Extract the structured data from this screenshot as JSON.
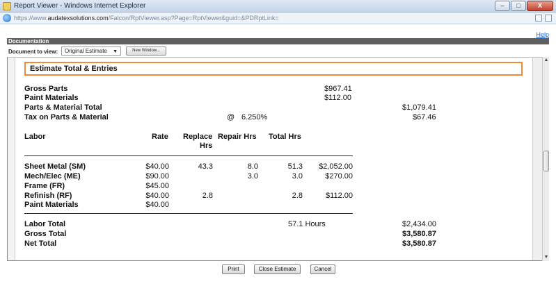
{
  "window": {
    "title": "Report Viewer - Windows Internet Explorer",
    "url_prefix": "https://www.",
    "url_domain": "audatexsolutions.com",
    "url_path": "/Falcon/RptViewer.asp?Page=RptViewer&guid=&PDRptLink=",
    "minimize": "–",
    "maximize": "□",
    "close": "X"
  },
  "help_label": "Help",
  "documentation": {
    "header": "Documentation",
    "doc_label": "Document to view:",
    "selected_doc": "Original Estimate",
    "new_window_label": "New Window..."
  },
  "report": {
    "section_title": "Estimate Total & Entries",
    "gross_parts_label": "Gross Parts",
    "gross_parts_value": "$967.41",
    "paint_materials_label": "Paint Materials",
    "paint_materials_value": "$112.00",
    "parts_material_total_label": "Parts & Material Total",
    "parts_material_total_value": "$1,079.41",
    "tax_label": "Tax on Parts & Material",
    "tax_at": "@",
    "tax_rate": "6.250%",
    "tax_value": "$67.46",
    "labor_headers": {
      "labor": "Labor",
      "rate": "Rate",
      "replace_line1": "Replace",
      "replace_line2": "Hrs",
      "repair": "Repair Hrs",
      "total": "Total Hrs"
    },
    "labor_rows": [
      {
        "name": "Sheet Metal (SM)",
        "rate": "$40.00",
        "replace": "43.3",
        "repair": "8.0",
        "total": "51.3",
        "amount": "$2,052.00"
      },
      {
        "name": "Mech/Elec (ME)",
        "rate": "$90.00",
        "replace": "",
        "repair": "3.0",
        "total": "3.0",
        "amount": "$270.00"
      },
      {
        "name": "Frame (FR)",
        "rate": "$45.00",
        "replace": "",
        "repair": "",
        "total": "",
        "amount": ""
      },
      {
        "name": "Refinish (RF)",
        "rate": "$40.00",
        "replace": "2.8",
        "repair": "",
        "total": "2.8",
        "amount": "$112.00"
      },
      {
        "name": "Paint Materials",
        "rate": "$40.00",
        "replace": "",
        "repair": "",
        "total": "",
        "amount": ""
      }
    ],
    "labor_total_label": "Labor Total",
    "labor_total_hours": "57.1 Hours",
    "labor_total_value": "$2,434.00",
    "gross_total_label": "Gross Total",
    "gross_total_value": "$3,580.87",
    "net_total_label": "Net Total",
    "net_total_value": "$3,580.87"
  },
  "buttons": {
    "print": "Print",
    "close_estimate": "Close Estimate",
    "cancel": "Cancel"
  }
}
